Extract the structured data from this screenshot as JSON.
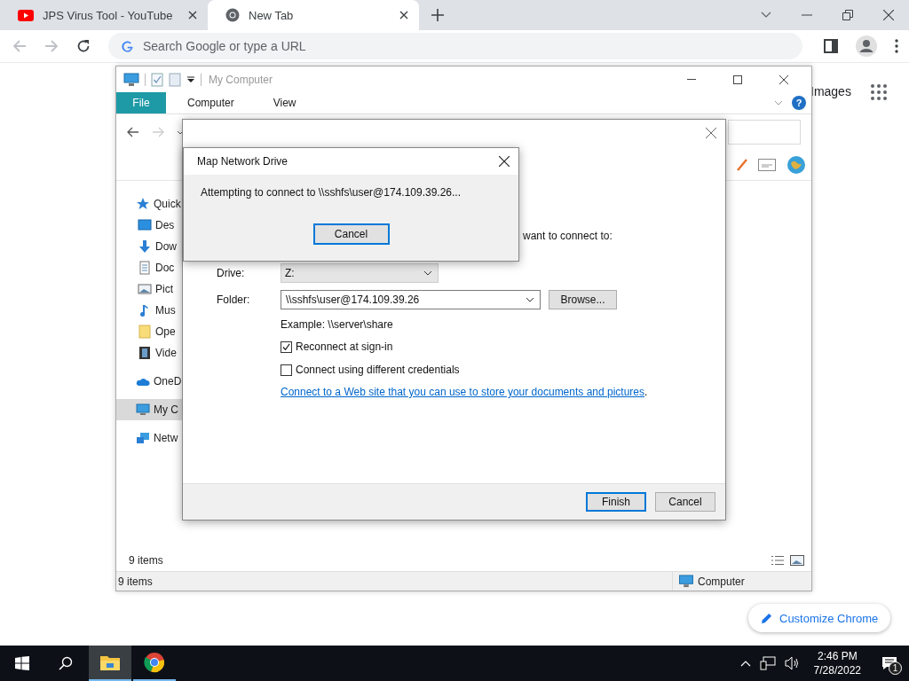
{
  "browser": {
    "tabs": [
      {
        "title": "JPS Virus Tool - YouTube",
        "selected": false
      },
      {
        "title": "New Tab",
        "selected": true
      }
    ],
    "address_placeholder": "Search Google or type a URL",
    "page": {
      "images_link": "Images",
      "customize_button": "Customize Chrome"
    }
  },
  "explorer": {
    "title": "My Computer",
    "ribbon_tabs": [
      {
        "label": "File",
        "kind": "file-menu"
      },
      {
        "label": "Computer",
        "kind": "tab"
      },
      {
        "label": "View",
        "kind": "tab"
      }
    ],
    "help_glyph": "?",
    "nav": [
      {
        "label": "Quick",
        "selected": false,
        "children": [
          {
            "label": "Des",
            "selected": false
          },
          {
            "label": "Dow",
            "selected": false
          },
          {
            "label": "Doc",
            "selected": false
          },
          {
            "label": "Pict",
            "selected": false
          },
          {
            "label": "Mus",
            "selected": false
          },
          {
            "label": "Ope",
            "selected": false
          },
          {
            "label": "Vide",
            "selected": false
          }
        ]
      },
      {
        "label": "OneD",
        "selected": false
      },
      {
        "label": "My C",
        "selected": true
      },
      {
        "label": "Netw",
        "selected": false
      }
    ],
    "item_count": "9 items",
    "status_bar": {
      "items": "9 items",
      "location": "Computer"
    }
  },
  "wizard": {
    "instruction_tail": "want to connect to:",
    "drive": {
      "label": "Drive:",
      "value": "Z:"
    },
    "folder": {
      "label": "Folder:",
      "value": "\\\\sshfs\\user@174.109.39.26"
    },
    "browse_button": "Browse...",
    "example": "Example: \\\\server\\share",
    "options": [
      {
        "label": "Reconnect at sign-in",
        "checked": true
      },
      {
        "label": "Connect using different credentials",
        "checked": false
      }
    ],
    "link": {
      "text": "Connect to a Web site that you can use to store your documents and pictures",
      "after": "."
    },
    "buttons": [
      {
        "label": "Finish",
        "default": true
      },
      {
        "label": "Cancel",
        "default": false
      }
    ]
  },
  "progress_dialog": {
    "title": "Map Network Drive",
    "message": "Attempting to connect to \\\\sshfs\\user@174.109.39.26...",
    "button": "Cancel"
  },
  "taskbar": {
    "apps": [
      {
        "active": true
      },
      {
        "active": false
      }
    ],
    "time": "2:46 PM",
    "date": "7/28/2022",
    "notification_count": "1"
  }
}
